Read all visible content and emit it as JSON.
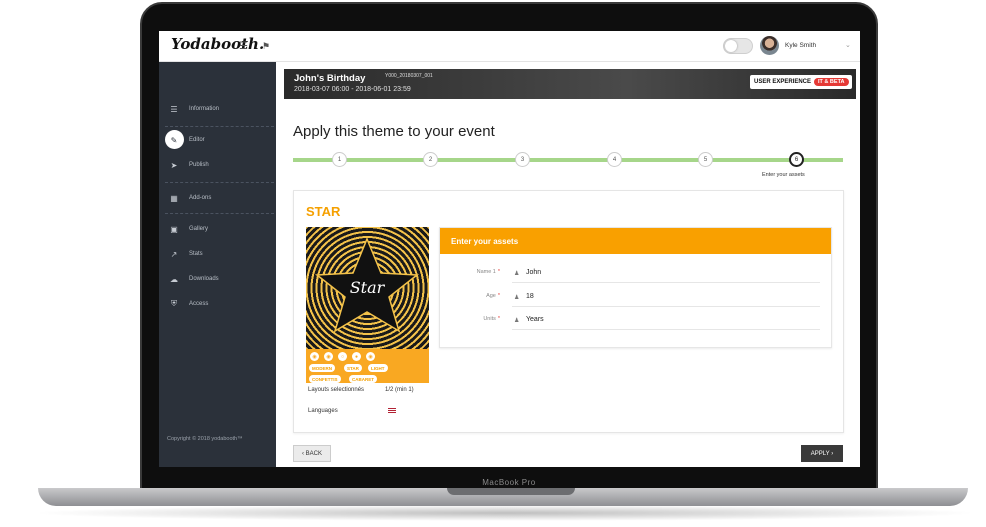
{
  "device": {
    "label": "MacBook Pro"
  },
  "topbar": {
    "logo": "Yodabooth.",
    "user_name": "Kyle Smith"
  },
  "sidebar": {
    "items": [
      {
        "label": "Information",
        "icon": "list-icon"
      },
      {
        "label": "Editor",
        "icon": "pencil-icon"
      },
      {
        "label": "Publish",
        "icon": "paper-plane-icon"
      },
      {
        "label": "Add-ons",
        "icon": "sitemap-icon"
      },
      {
        "label": "Gallery",
        "icon": "image-icon"
      },
      {
        "label": "Stats",
        "icon": "line-chart-icon"
      },
      {
        "label": "Downloads",
        "icon": "cloud-download-icon"
      },
      {
        "label": "Access",
        "icon": "shield-icon"
      }
    ],
    "active_index": 1,
    "copyright": "Copyright © 2018 yodabooth™"
  },
  "event": {
    "title": "John's Birthday",
    "id": "Y000_20180307_001",
    "dates": "2018-03-07 06:00 - 2018-06-01 23:59",
    "ux_label": "USER EXPERIENCE",
    "beta_label": "IT & BETA"
  },
  "main": {
    "title": "Apply this theme to your event",
    "steps": [
      "1",
      "2",
      "3",
      "4",
      "5",
      "6"
    ],
    "current_step": 6,
    "current_step_label": "Enter your assets"
  },
  "theme": {
    "name": "STAR",
    "preview_text": "Star",
    "tags": [
      "MODERN",
      "STAR",
      "LIGHT",
      "CONFETTIS",
      "CABARET"
    ],
    "layouts_label": "Layouts selectionnés",
    "layouts_value": "1/2 (min 1)",
    "languages_label": "Languages"
  },
  "assets": {
    "header": "Enter your assets",
    "fields": [
      {
        "label": "Name 1",
        "value": "John"
      },
      {
        "label": "Age",
        "value": "18"
      },
      {
        "label": "Units",
        "value": "Years"
      }
    ]
  },
  "actions": {
    "back": "BACK",
    "apply": "APPLY"
  },
  "colors": {
    "accent": "#f9a000",
    "sidebar": "#2b313a",
    "stepper": "#a6d68a",
    "beta": "#e53935"
  }
}
